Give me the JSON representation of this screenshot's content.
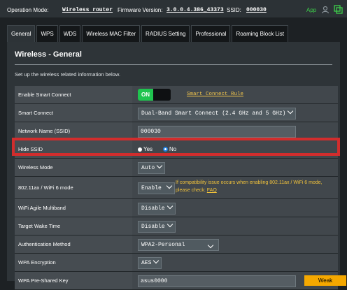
{
  "topbar": {
    "mode_label": "Operation Mode:",
    "mode_value": "Wireless router",
    "fw_label": "Firmware Version:",
    "fw_value": "3.0.0.4.386_43373",
    "ssid_label": "SSID:",
    "ssid_value": "000030",
    "app_label": "App"
  },
  "tabs": [
    "General",
    "WPS",
    "WDS",
    "Wireless MAC Filter",
    "RADIUS Setting",
    "Professional",
    "Roaming Block List"
  ],
  "page": {
    "title": "Wireless - General",
    "description": "Set up the wireless related information below."
  },
  "rows": {
    "smart_connect_enable": {
      "label": "Enable Smart Connect",
      "toggle": "ON",
      "link": "Smart Connect Rule"
    },
    "smart_connect": {
      "label": "Smart Connect",
      "value": "Dual-Band Smart Connect (2.4 GHz and 5 GHz)"
    },
    "ssid": {
      "label": "Network Name (SSID)",
      "value": "000030"
    },
    "hide_ssid": {
      "label": "Hide SSID",
      "yes": "Yes",
      "no": "No",
      "selected": "No"
    },
    "wireless_mode": {
      "label": "Wireless Mode",
      "value": "Auto"
    },
    "ax_mode": {
      "label": "802.11ax / WiFi 6 mode",
      "value": "Enable",
      "warning": "If compatibility issue occurs when enabling 802.11ax / WiFi 6 mode, please check:",
      "faq": "FAQ"
    },
    "agile_multiband": {
      "label": "WiFi Agile Multiband",
      "value": "Disable"
    },
    "twt": {
      "label": "Target Wake Time",
      "value": "Disable"
    },
    "auth": {
      "label": "Authentication Method",
      "value": "WPA2-Personal"
    },
    "encryption": {
      "label": "WPA Encryption",
      "value": "AES"
    },
    "psk": {
      "label": "WPA Pre-Shared Key",
      "value": "asus0000",
      "strength": "Weak"
    }
  },
  "colors": {
    "accent_green": "#1fc44f",
    "highlight_red": "#d22d2d",
    "warning_yellow": "#f2c33b",
    "weak_orange": "#f5a800"
  }
}
